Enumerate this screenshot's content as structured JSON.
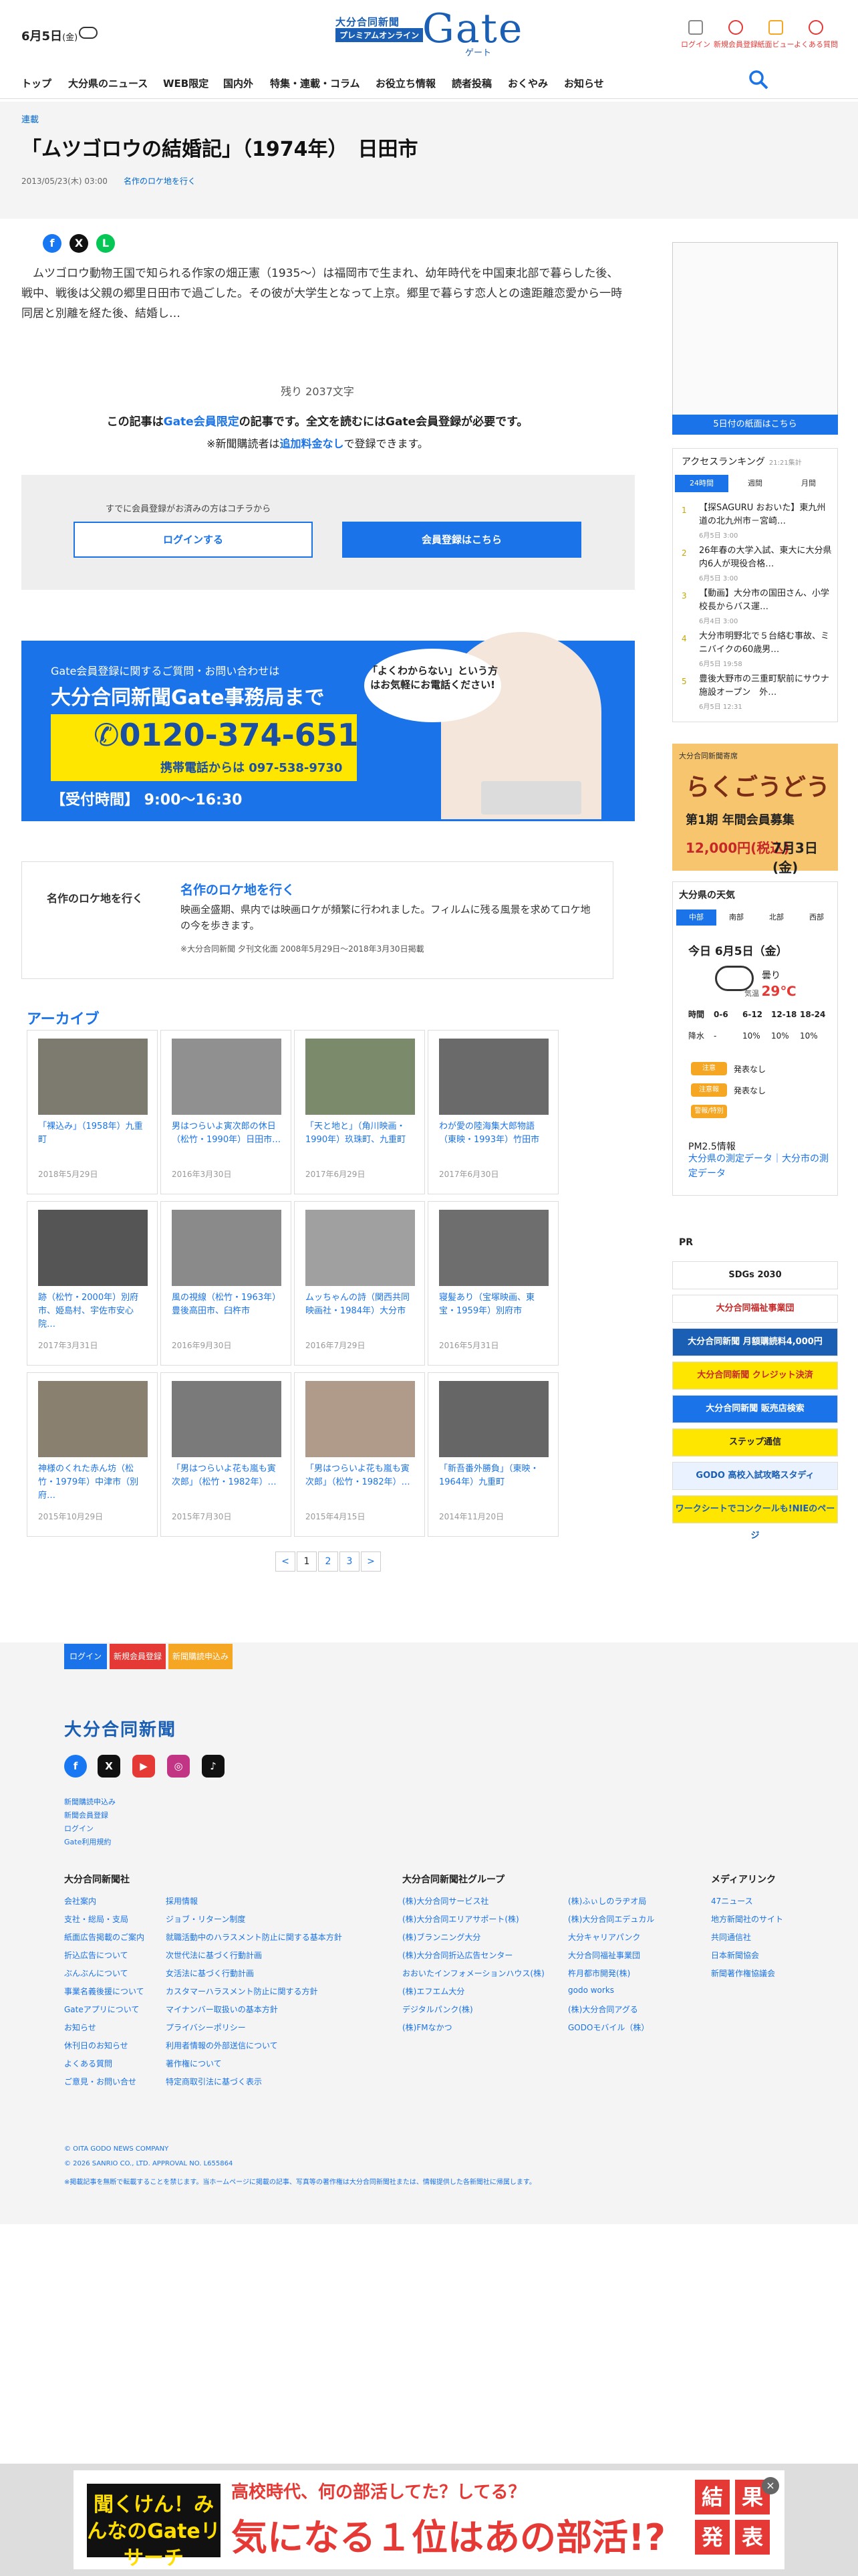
{
  "header": {
    "date": "6月5日",
    "weekday": "(金)",
    "logo_line1": "大分合同新聞",
    "logo_line2": "プレミアムオンライン",
    "logo_main": "Gate",
    "logo_kana": "ゲート",
    "icons": [
      {
        "label": "ログイン",
        "icon": "login-icon"
      },
      {
        "label": "新規会員登録",
        "icon": "register-icon"
      },
      {
        "label": "紙面ビュー",
        "icon": "paper-icon"
      },
      {
        "label": "よくある質問",
        "icon": "faq-icon"
      }
    ]
  },
  "nav": [
    "トップ",
    "大分県のニュース",
    "WEB限定",
    "国内外",
    "特集・連載・コラム",
    "お役立ち情報",
    "読者投稿",
    "おくやみ",
    "お知らせ"
  ],
  "article": {
    "category": "連載",
    "title": "「ムツゴロウの結婚記」（1974年）　日田市",
    "date": "2013/05/23(木) 03:00",
    "series_link": "名作のロケ地を行く",
    "body": "　ムツゴロウ動物王国で知られる作家の畑正憲（1935〜）は福岡市で生まれ、幼年時代を中国東北部で暮らした後、戦中、戦後は父親の郷里日田市で過ごした。その彼が大学生となって上京。郷里で暮らす恋人との遠距離恋愛から一時同居と別離を経た後、結婚し…",
    "remaining": "残り 2037文字",
    "notice_a": "この記事は",
    "notice_b": "Gate会員限定",
    "notice_c": "の記事です。全文を読むにはGate会員登録が必要です。",
    "notice2_a": "※新聞購読者は",
    "notice2_b": "追加料金なし",
    "notice2_c": "で登録できます。",
    "login_hint": "すでに会員登録がお済みの方はコチラから",
    "login_btn": "ログインする",
    "register_btn": "会員登録はこちら"
  },
  "contact": {
    "sub": "Gate会員登録に関するご質問・お問い合わせは",
    "title": "大分合同新聞Gate事務局まで",
    "phone": "0120-374-651",
    "mobile": "携帯電話からは 097-538-9730",
    "hours": "【受付時間】 9:00〜16:30",
    "bubble": "「よくわからない」という方はお気軽にお電話ください!"
  },
  "series": {
    "img": "名作のロケ地を行く",
    "title": "名作のロケ地を行く",
    "desc": "映画全盛期、県内では映画ロケが頻繁に行われました。フィルムに残る風景を求めてロケ地の今を歩きます。",
    "note": "※大分合同新聞 夕刊文化面 2008年5月29日〜2018年3月30日掲載"
  },
  "archive": {
    "title": "アーカイブ",
    "cards": [
      {
        "title": "「裸込み」（1958年）九重町",
        "date": "2018年5月29日"
      },
      {
        "title": "男はつらいよ寅次郎の休日（松竹・1990年）日田市…",
        "date": "2016年3月30日"
      },
      {
        "title": "「天と地と」（角川映画・1990年）玖珠町、九重町",
        "date": "2017年6月29日"
      },
      {
        "title": "わが愛の陸海集大郎物語（東映・1993年）竹田市",
        "date": "2017年6月30日"
      },
      {
        "title": "跡（松竹・2000年）別府市、姫島村、宇佐市安心院…",
        "date": "2017年3月31日"
      },
      {
        "title": "風の視線（松竹・1963年）豊後高田市、臼杵市",
        "date": "2016年9月30日"
      },
      {
        "title": "ムッちゃんの詩（関西共同映画社・1984年）大分市",
        "date": "2016年7月29日"
      },
      {
        "title": "寝髪あり（宝塚映画、東宝・1959年）別府市",
        "date": "2016年5月31日"
      },
      {
        "title": "神様のくれた赤ん坊（松竹・1979年）中津市（別府…",
        "date": "2015年10月29日"
      },
      {
        "title": "「男はつらいよ花も嵐も寅次郎」（松竹・1982年）…",
        "date": "2015年7月30日"
      },
      {
        "title": "「男はつらいよ花も嵐も寅次郎」（松竹・1982年）…",
        "date": "2015年4月15日"
      },
      {
        "title": "「新吾番外勝負」（東映・1964年）九重町",
        "date": "2014年11月20日"
      }
    ]
  },
  "pager": [
    "<",
    "1",
    "2",
    "3",
    ">"
  ],
  "sidebar": {
    "paper_btn": "5日付の紙面はこちら",
    "rank_title": "アクセスランキング",
    "rank_updated": "21:21集計",
    "rank_tabs": [
      "24時間",
      "週間",
      "月間"
    ],
    "ranking": [
      {
        "n": "1",
        "title": "【探SAGURU おおいた】東九州道の北九州市－宮崎…",
        "date": "6月5日 3:00"
      },
      {
        "n": "2",
        "title": "26年春の大学入試、東大に大分県内6人が現役合格…",
        "date": "6月5日 3:00"
      },
      {
        "n": "3",
        "title": "【動画】大分市の国田さん、小学校長からバス運…",
        "date": "6月4日 3:00"
      },
      {
        "n": "4",
        "title": "大分市明野北で５台絡む事故、ミニバイクの60歳男…",
        "date": "6月5日 19:58"
      },
      {
        "n": "5",
        "title": "豊後大野市の三重町駅前にサウナ施設オープン　外…",
        "date": "6月5日 12:31"
      }
    ],
    "rakugo": {
      "title": "らくごうどう",
      "sub": "大分合同新聞寄席",
      "label": "第1期 年間会員募集",
      "price": "12,000円(税込)",
      "deadline": "7月3日(金)"
    },
    "weather_title": "大分県の天気",
    "weather_tabs": [
      "中部",
      "南部",
      "北部",
      "西部"
    ],
    "weather_date": "今日 6月5日（金）",
    "weather_desc": "曇り",
    "weather_temp_label": "気温",
    "weather_temp": "29℃",
    "weather_times": [
      "時間",
      "0-6",
      "6-12",
      "12-18",
      "18-24"
    ],
    "weather_rain": [
      "降水",
      "-",
      "10%",
      "10%",
      "10%"
    ],
    "alerts": [
      {
        "tag": "注意",
        "text": "発表なし"
      },
      {
        "tag": "注意報",
        "text": "発表なし"
      },
      {
        "tag": "警報/特別",
        "text": ""
      }
    ],
    "pm_title": "PM2.5情報",
    "pm_link": "大分県の測定データ｜大分市の測定データ",
    "pr_title": "PR",
    "pr": [
      "SDGs 2030",
      "大分合同福祉事業団",
      "大分合同新聞 月額購読料4,000円",
      "大分合同新聞 クレジット決済",
      "大分合同新聞 販売店検索",
      "ステップ通信",
      "GODO 高校入試攻略スタディ",
      "ワークシートでコンクールも!NIEのページ"
    ]
  },
  "footer": {
    "btns": [
      "ログイン",
      "新規会員登録",
      "新聞購読申込み"
    ],
    "logo": "大分合同新聞",
    "small_links": [
      "新聞購読申込み",
      "新聞会員登録",
      "ログイン",
      "Gate利用規約"
    ],
    "col1_head": "大分合同新聞社",
    "col1": [
      "会社案内",
      "支社・総局・支局",
      "紙面広告掲載のご案内",
      "折込広告について",
      "ぶんぶんについて",
      "事業名義後援について",
      "Gateアプリについて",
      "お知らせ",
      "休刊日のお知らせ",
      "よくある質問",
      "ご意見・お問い合せ"
    ],
    "col2": [
      "採用情報",
      "ジョブ・リターン制度",
      "就職活動中のハラスメント防止に関する基本方針",
      "次世代法に基づく行動計画",
      "女活法に基づく行動計画",
      "カスタマーハラスメント防止に関する方針",
      "マイナンバー取扱いの基本方針",
      "プライバシーポリシー",
      "利用者情報の外部送信について",
      "著作権について",
      "特定商取引法に基づく表示"
    ],
    "col3_head": "大分合同新聞社グループ",
    "col3": [
      "(株)大分合同サービス社",
      "(株)大分合同エリアサポート(株)",
      "(株)ブランニング大分",
      "(株)大分合同折込広告センター",
      "おおいたインフォメーションハウス(株)",
      "(株)エフエム大分",
      "デジタルパンク(株)",
      "(株)FMなかつ"
    ],
    "col4": [
      "(株)ふぃしのラヂオ局",
      "(株)大分合同エデュカル",
      "大分キャリアパンク",
      "大分合同福祉事業団",
      "杵月都市開発(株)",
      "godo works",
      "(株)大分合同アグる",
      "GODOモバイル（株）"
    ],
    "col5_head": "メディアリンク",
    "col5": [
      "47ニュース",
      "地方新聞社のサイト",
      "共同通信社",
      "日本新聞協会",
      "新聞著作権協議会"
    ],
    "copy1": "© OITA GODO NEWS COMPANY",
    "copy2": "© 2026 SANRIO CO., LTD. APPROVAL NO. L655864",
    "copy3": "※掲載記事を無断で転載することを禁じます。当ホームページに掲載の記事、写真等の著作権は大分合同新聞社または、情報提供した各新聞社に帰属します。"
  },
  "bottom_ad": {
    "logo": "聞くけん！みんなのGateリサーチ",
    "sub": "高校時代、何の部活してた？してる？",
    "main": "気になる１位はあの部活!?",
    "kanji": [
      "結",
      "果",
      "発",
      "表"
    ]
  },
  "colors": {
    "accent": "#1a73e8",
    "brand": "#1a5fb4",
    "alert": "#e53935"
  }
}
